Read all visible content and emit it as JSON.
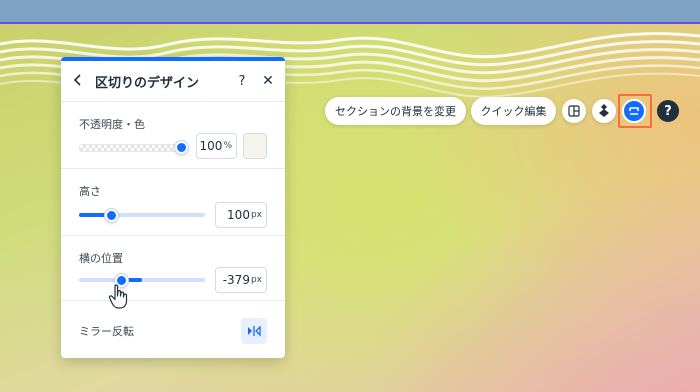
{
  "panel": {
    "title": "区切りのデザイン",
    "back_icon": "chevron-left-icon",
    "help_label": "?",
    "close_label": "✕"
  },
  "opacity": {
    "label": "不透明度・色",
    "value": "100",
    "unit": "%",
    "level": 1.0,
    "swatch_color": "#f7f4ee"
  },
  "height": {
    "label": "高さ",
    "value": "100",
    "unit": "px",
    "level": 0.25
  },
  "horizontal_position": {
    "label": "横の位置",
    "value": "-379",
    "unit": "px",
    "level": 0.33
  },
  "mirror": {
    "label": "ミラー反転",
    "icon": "mirror-flip-icon"
  },
  "toolbar": {
    "change_background_label": "セクションの背景を変更",
    "quick_edit_label": "クイック編集",
    "layout_icon": "layout-icon",
    "animation_icon": "layers-diamond-icon",
    "divider_icon": "divider-icon",
    "help_label": "?"
  },
  "colors": {
    "accent": "#116dff",
    "highlight": "#ff6a3d"
  }
}
